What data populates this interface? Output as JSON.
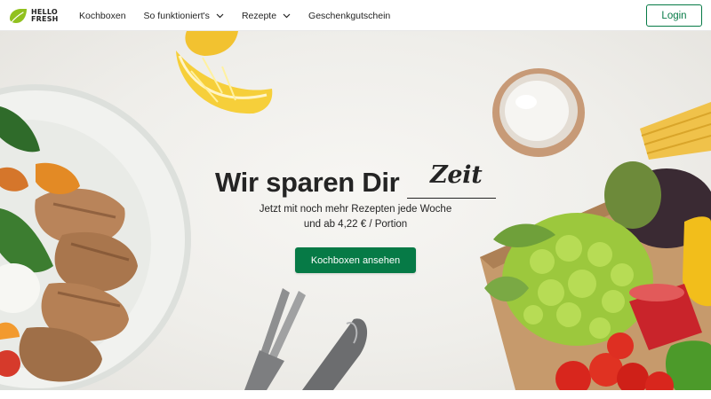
{
  "header": {
    "logo": {
      "line1": "HELLO",
      "line2": "FRESH"
    },
    "nav": [
      {
        "label": "Kochboxen",
        "dropdown": false
      },
      {
        "label": "So funktioniert's",
        "dropdown": true
      },
      {
        "label": "Rezepte",
        "dropdown": true
      },
      {
        "label": "Geschenkgutschein",
        "dropdown": false
      }
    ],
    "login_label": "Login"
  },
  "hero": {
    "headline_prefix": "Wir sparen Dir",
    "headline_highlight": "Zeit",
    "subline_1": "Jetzt mit noch mehr Rezepten jede Woche",
    "subline_2": "und ab 4,22 € / Portion",
    "cta_label": "Kochboxen ansehen"
  },
  "colors": {
    "brand_green": "#067a46",
    "logo_green": "#91c11e",
    "text": "#242424",
    "hero_background": "#efeeea"
  },
  "icons": [
    "hellofresh-logo-icon",
    "chevron-down-icon"
  ]
}
